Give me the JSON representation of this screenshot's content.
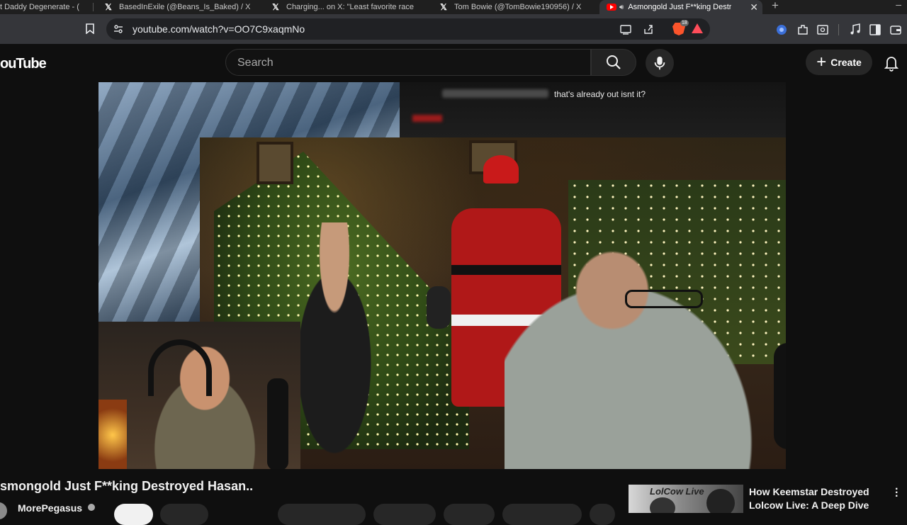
{
  "browser": {
    "tabs": [
      {
        "title": "t Daddy Degenerate - (",
        "favicon": "generic",
        "active": false
      },
      {
        "title": "BasedInExile (@Beans_Is_Baked) / X",
        "favicon": "x-logo",
        "active": false
      },
      {
        "title": "Charging... on X: \"Least favorite race",
        "favicon": "x-logo",
        "active": false
      },
      {
        "title": "Tom Bowie (@TomBowie190956) / X",
        "favicon": "x-logo",
        "active": false
      },
      {
        "title": "Asmongold Just F**king Destr",
        "favicon": "youtube-logo",
        "active": true,
        "audio": true
      }
    ],
    "url": "youtube.com/watch?v=OO7C9xaqmNo",
    "brave_shield_count": "18"
  },
  "youtube": {
    "logo_text": "ouTube",
    "search": {
      "placeholder": "Search",
      "value": ""
    },
    "create_label": "Create"
  },
  "video": {
    "chat_message": "that's already out isnt it?"
  },
  "below_video": {
    "title": "smongold Just F**king Destroyed Hasan..",
    "channel_name": "MorePegasus"
  },
  "recommendation": {
    "thumb_label": "LolCow Live",
    "title": "How Keemstar Destroyed Lolcow Live: A Deep Dive"
  },
  "colors": {
    "background": "#0f0f0f",
    "youtube_red": "#ff0000",
    "browser_toolbar": "#35363a",
    "tab_strip": "#1f1f1f"
  }
}
